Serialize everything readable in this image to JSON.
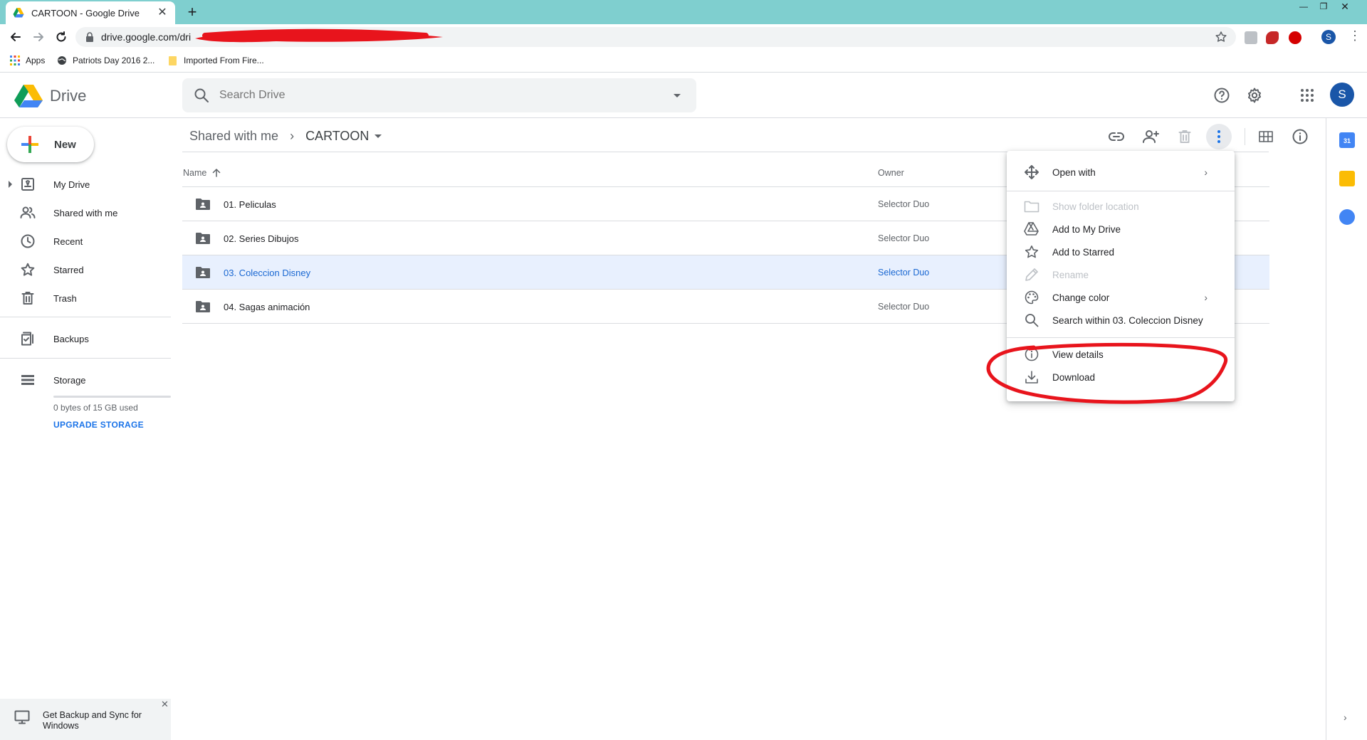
{
  "browser": {
    "tab_title": "CARTOON - Google Drive",
    "url_text": "drive.google.com/dri",
    "bookmarks": [
      {
        "label": "Apps",
        "icon": "apps-grid-icon"
      },
      {
        "label": "Patriots Day 2016 2...",
        "icon": "globe-icon"
      },
      {
        "label": "Imported From Fire...",
        "icon": "folder-icon"
      }
    ],
    "profile_initial": "S"
  },
  "header": {
    "app_name": "Drive",
    "search_placeholder": "Search Drive",
    "avatar_initial": "S"
  },
  "sidebar": {
    "new_label": "New",
    "items": [
      {
        "label": "My Drive",
        "icon": "my-drive-icon"
      },
      {
        "label": "Shared with me",
        "icon": "shared-icon"
      },
      {
        "label": "Recent",
        "icon": "clock-icon"
      },
      {
        "label": "Starred",
        "icon": "star-icon"
      },
      {
        "label": "Trash",
        "icon": "trash-icon"
      },
      {
        "label": "Backups",
        "icon": "backup-icon"
      },
      {
        "label": "Storage",
        "icon": "storage-icon"
      }
    ],
    "storage_used": "0 bytes of 15 GB used",
    "upgrade_label": "UPGRADE STORAGE",
    "backup_promo": "Get Backup and Sync for Windows"
  },
  "main": {
    "breadcrumb": {
      "parent": "Shared with me",
      "current": "CARTOON"
    },
    "columns": {
      "name": "Name",
      "owner": "Owner"
    },
    "rows": [
      {
        "name": "01. Peliculas",
        "owner": "Selector Duo",
        "selected": false
      },
      {
        "name": "02. Series Dibujos",
        "owner": "Selector Duo",
        "selected": false
      },
      {
        "name": "03. Coleccion Disney",
        "owner": "Selector Duo",
        "selected": true
      },
      {
        "name": "04. Sagas animación",
        "owner": "Selector Duo",
        "selected": false
      }
    ]
  },
  "context_menu": {
    "items": [
      {
        "label": "Open with",
        "icon": "open-with-icon",
        "submenu": true,
        "disabled": false
      },
      {
        "label": "Show folder location",
        "icon": "folder-icon",
        "submenu": false,
        "disabled": true
      },
      {
        "label": "Add to My Drive",
        "icon": "add-to-drive-icon",
        "submenu": false,
        "disabled": false
      },
      {
        "label": "Add to Starred",
        "icon": "star-icon",
        "submenu": false,
        "disabled": false
      },
      {
        "label": "Rename",
        "icon": "pencil-icon",
        "submenu": false,
        "disabled": true
      },
      {
        "label": "Change color",
        "icon": "palette-icon",
        "submenu": true,
        "disabled": false
      },
      {
        "label": "Search within 03. Coleccion Disney",
        "icon": "search-icon",
        "submenu": false,
        "disabled": false
      },
      {
        "label": "View details",
        "icon": "info-icon",
        "submenu": false,
        "disabled": false
      },
      {
        "label": "Download",
        "icon": "download-icon",
        "submenu": false,
        "disabled": false
      }
    ]
  },
  "colors": {
    "accent": "#1a73e8",
    "selection": "#e8f0fe",
    "tabbar": "#7fcfcf",
    "annotation": "#e8141c"
  }
}
